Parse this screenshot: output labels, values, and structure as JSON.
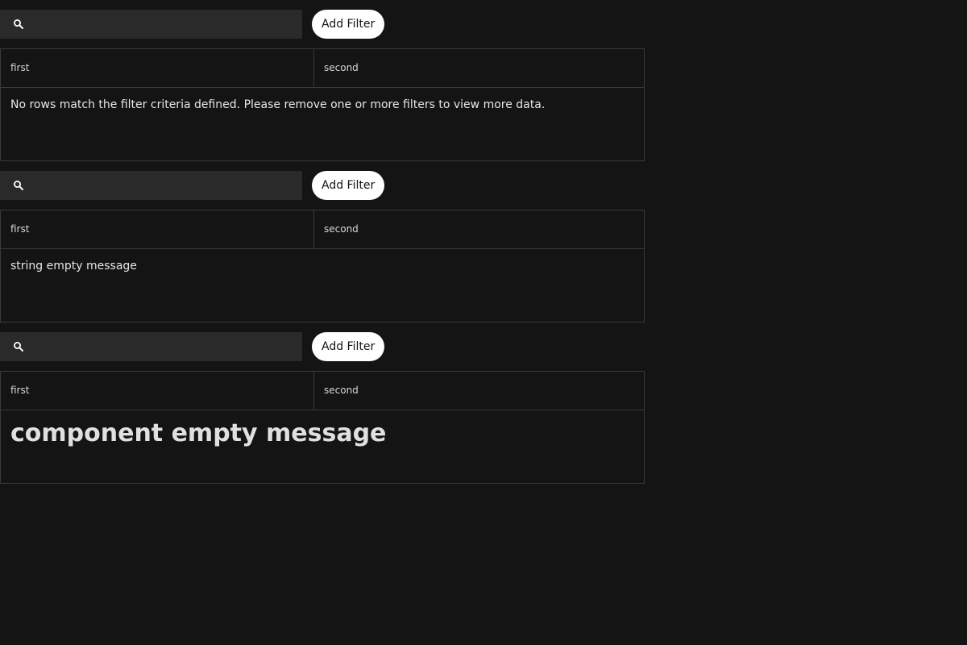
{
  "panels": [
    {
      "search": {
        "value": "",
        "placeholder": ""
      },
      "add_filter_label": "Add Filter",
      "columns": [
        "first",
        "second"
      ],
      "empty_message": "No rows match the filter criteria defined. Please remove one or more filters to view more data."
    },
    {
      "search": {
        "value": "",
        "placeholder": ""
      },
      "add_filter_label": "Add Filter",
      "columns": [
        "first",
        "second"
      ],
      "empty_message": "string empty message"
    },
    {
      "search": {
        "value": "",
        "placeholder": ""
      },
      "add_filter_label": "Add Filter",
      "columns": [
        "first",
        "second"
      ],
      "empty_message": "component empty message"
    }
  ],
  "icons": {
    "search": "search-icon"
  },
  "colors": {
    "background": "#141414",
    "search_bg": "#2a2a2a",
    "button_bg": "#ffffff",
    "border": "#3a3a3a"
  }
}
